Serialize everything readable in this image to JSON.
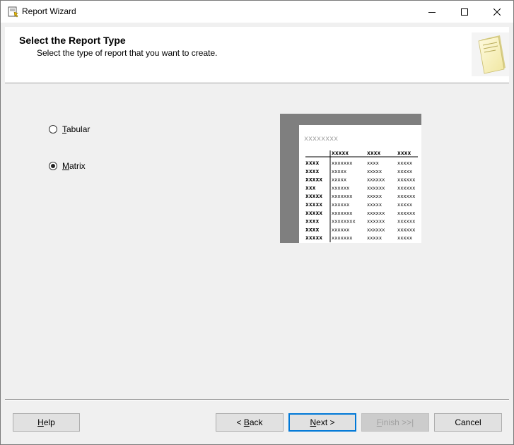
{
  "window": {
    "title": "Report Wizard",
    "minimize_glyph": "minimize-icon",
    "maximize_glyph": "maximize-icon",
    "close_glyph": "close-icon"
  },
  "header": {
    "title": "Select the Report Type",
    "subtitle": "Select the type of report that you want to create."
  },
  "options": {
    "tabular": {
      "accel": "T",
      "rest": "abular",
      "checked": false
    },
    "matrix": {
      "accel": "M",
      "rest": "atrix",
      "checked": true
    }
  },
  "preview": {
    "title": "xxxxxxxx",
    "header_row": [
      "",
      "xxxxx",
      "xxxx",
      "xxxx"
    ],
    "rows": [
      [
        "xxxx",
        "xxxxxxx",
        "xxxx",
        "xxxxx"
      ],
      [
        "xxxx",
        "xxxxx",
        "xxxxx",
        "xxxxx"
      ],
      [
        "xxxxx",
        "xxxxx",
        "xxxxxx",
        "xxxxxx"
      ],
      [
        "xxx",
        "xxxxxx",
        "xxxxxx",
        "xxxxxx"
      ],
      [
        "xxxxx",
        "xxxxxxx",
        "xxxxx",
        "xxxxxx"
      ],
      [
        "xxxxx",
        "xxxxxx",
        "xxxxx",
        "xxxxx"
      ],
      [
        "xxxxx",
        "xxxxxxx",
        "xxxxxx",
        "xxxxxx"
      ],
      [
        "xxxx",
        "xxxxxxxx",
        "xxxxxx",
        "xxxxxx"
      ],
      [
        "xxxx",
        "xxxxxx",
        "xxxxxx",
        "xxxxxx"
      ],
      [
        "xxxxx",
        "xxxxxxx",
        "xxxxx",
        "xxxxx"
      ]
    ]
  },
  "buttons": {
    "help": {
      "accel": "H",
      "rest": "elp"
    },
    "back": {
      "pre": "< ",
      "accel": "B",
      "rest": "ack"
    },
    "next": {
      "accel": "N",
      "rest": "ext >"
    },
    "finish": {
      "accel": "F",
      "rest": "inish >>|",
      "enabled": false
    },
    "cancel": {
      "label": "Cancel"
    }
  },
  "colors": {
    "accent": "#0078d7",
    "preview_frame": "#7f7f7f",
    "preview_title": "#a0a0a0"
  }
}
